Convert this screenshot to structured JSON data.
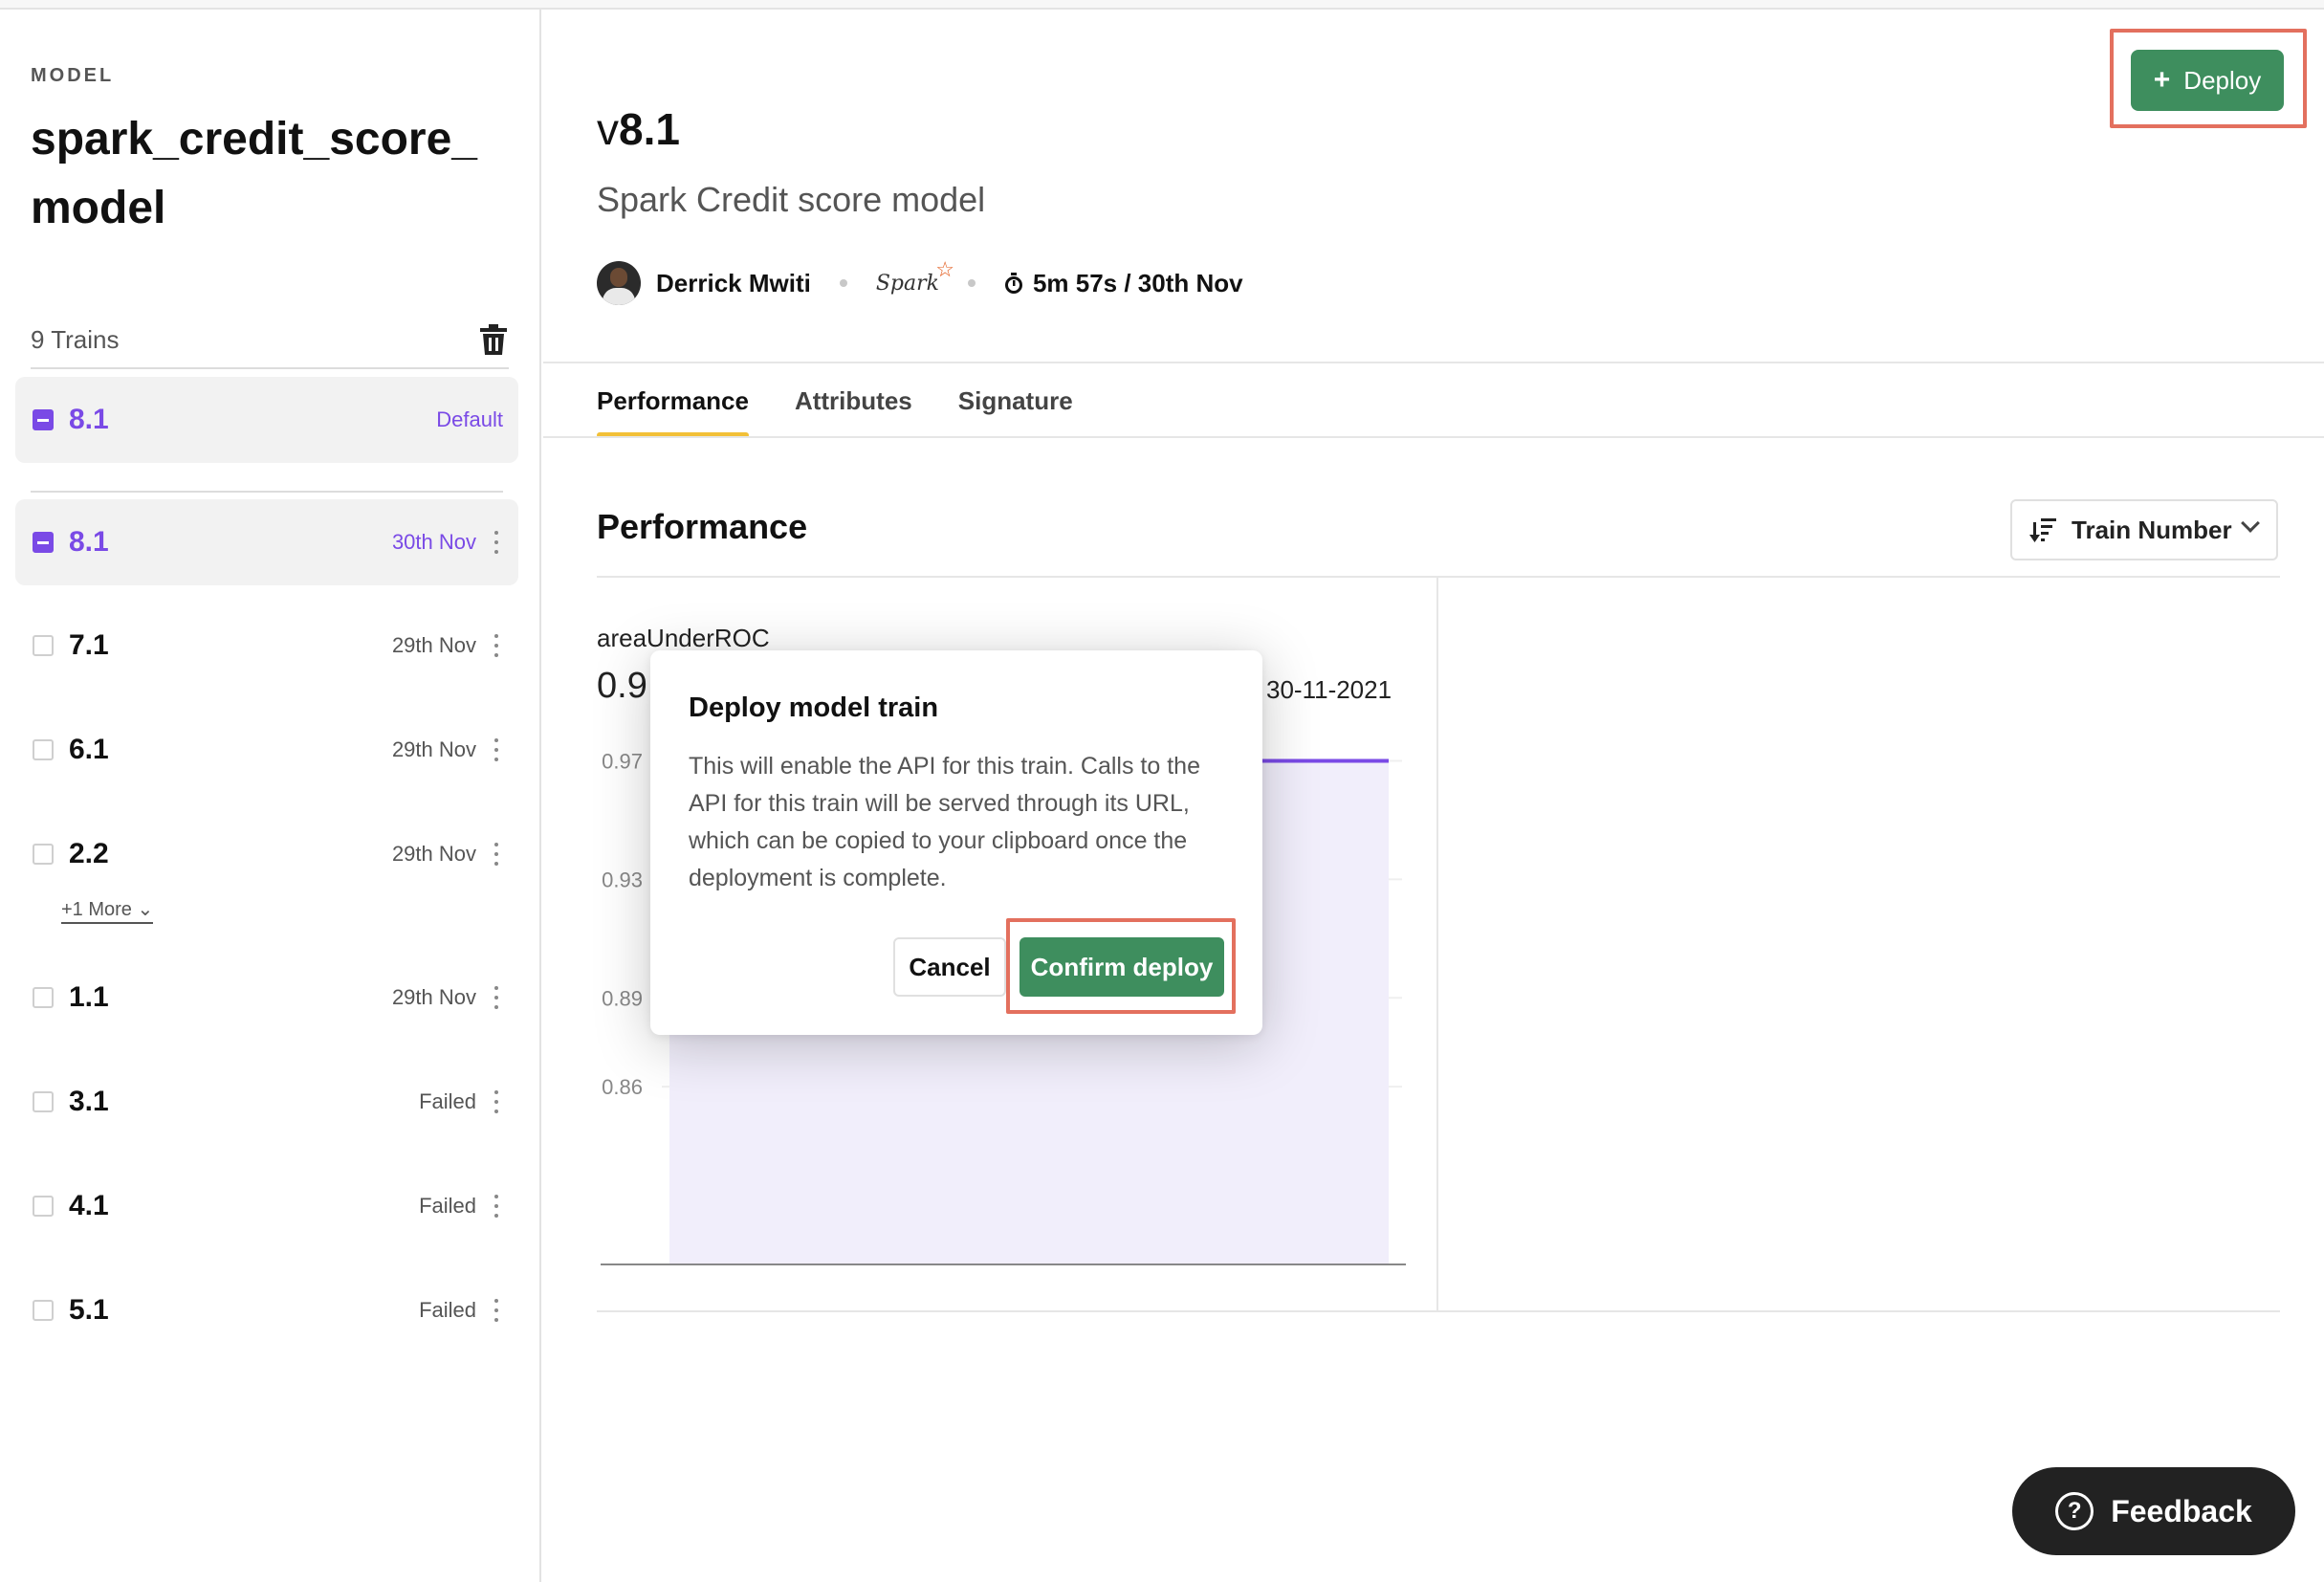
{
  "sidebar": {
    "eyebrow": "MODEL",
    "title": "spark_credit_score_model",
    "trains_count": "9 Trains",
    "default_train": {
      "version": "8.1",
      "label": "Default"
    },
    "trains": [
      {
        "version": "8.1",
        "date": "30th Nov",
        "selected": true
      },
      {
        "version": "7.1",
        "date": "29th Nov"
      },
      {
        "version": "6.1",
        "date": "29th Nov"
      },
      {
        "version": "2.2",
        "date": "29th Nov",
        "more": "+1 More"
      },
      {
        "version": "1.1",
        "date": "29th Nov"
      },
      {
        "version": "3.1",
        "date": "Failed"
      },
      {
        "version": "4.1",
        "date": "Failed"
      },
      {
        "version": "5.1",
        "date": "Failed"
      }
    ]
  },
  "header": {
    "version_prefix": "v",
    "version": "8.1",
    "subtitle": "Spark Credit score model",
    "author": "Derrick Mwiti",
    "framework": "Spark",
    "duration": "5m 57s / 30th Nov",
    "deploy_label": "Deploy"
  },
  "tabs": [
    "Performance",
    "Attributes",
    "Signature"
  ],
  "performance": {
    "title": "Performance",
    "sort_label": "Train Number",
    "metric_name": "areaUnderROC",
    "metric_value": "0.9",
    "date": "30-11-2021"
  },
  "chart_data": {
    "type": "area",
    "title": "areaUnderROC",
    "xlabel": "",
    "ylabel": "",
    "y_ticks": [
      "0.97",
      "0.93",
      "0.89",
      "0.86"
    ],
    "y_tick_values": [
      0.97,
      0.93,
      0.89,
      0.86
    ],
    "ylim": [
      0.8,
      0.975
    ],
    "series": [
      {
        "values": [
          0.97,
          0.97
        ]
      }
    ],
    "colors": {
      "line": "#7a4ae6",
      "fill": "#f1eefb"
    }
  },
  "modal": {
    "title": "Deploy model train",
    "body": "This will enable the API for this train. Calls to the API for this train will be served through its URL, which can be copied to your clipboard once the deployment is complete.",
    "cancel_label": "Cancel",
    "confirm_label": "Confirm deploy"
  },
  "feedback_label": "Feedback",
  "colors": {
    "accent": "#7a4ae6",
    "primary_button": "#3e8e5e",
    "highlight": "#e3705e",
    "tab_underline": "#f2c037"
  }
}
